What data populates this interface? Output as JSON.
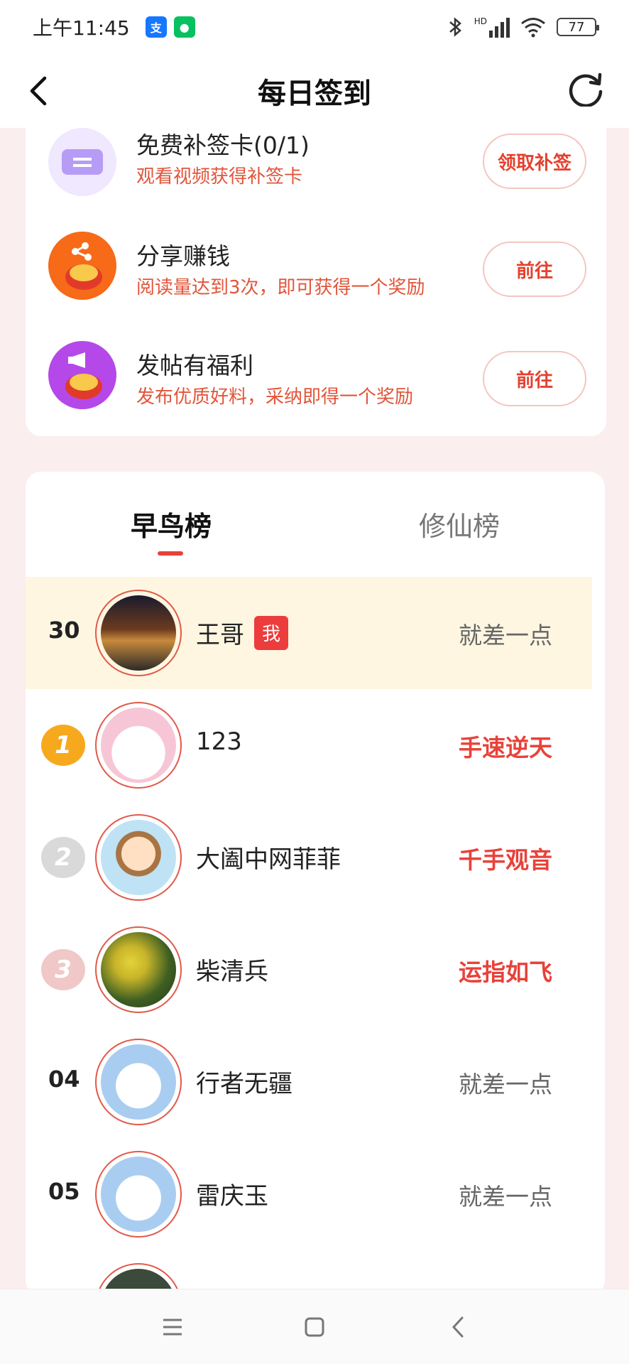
{
  "status_bar": {
    "time": "上午11:45",
    "battery": "77",
    "signal_label": "HD"
  },
  "header": {
    "title": "每日签到"
  },
  "tasks": [
    {
      "name": "免费补签卡(0/1)",
      "desc": "观看视频获得补签卡",
      "button": "领取补签",
      "icon": "ticket-icon"
    },
    {
      "name": "分享赚钱",
      "desc": "阅读量达到3次，即可获得一个奖励",
      "button": "前往",
      "icon": "share-icon"
    },
    {
      "name": "发帖有福利",
      "desc": "发布优质好料，采纳即得一个奖励",
      "button": "前往",
      "icon": "megaphone-icon"
    }
  ],
  "leaderboard": {
    "tabs": [
      "早鸟榜",
      "修仙榜"
    ],
    "me_badge": "我",
    "rows": [
      {
        "rank": "30",
        "name": "王哥",
        "status": "就差一点",
        "is_me": true
      },
      {
        "rank": "1",
        "name": "123",
        "status": "手速逆天"
      },
      {
        "rank": "2",
        "name": "大阖中网菲菲",
        "status": "千手观音"
      },
      {
        "rank": "3",
        "name": "柴清兵",
        "status": "运指如飞"
      },
      {
        "rank": "04",
        "name": "行者无疆",
        "status": "就差一点"
      },
      {
        "rank": "05",
        "name": "雷庆玉",
        "status": "就差一点"
      }
    ]
  },
  "colors": {
    "accent": "#e8423a",
    "task_desc": "#e2553a",
    "me_row_bg": "#fef6e1",
    "page_bg": "#fbeeee"
  }
}
